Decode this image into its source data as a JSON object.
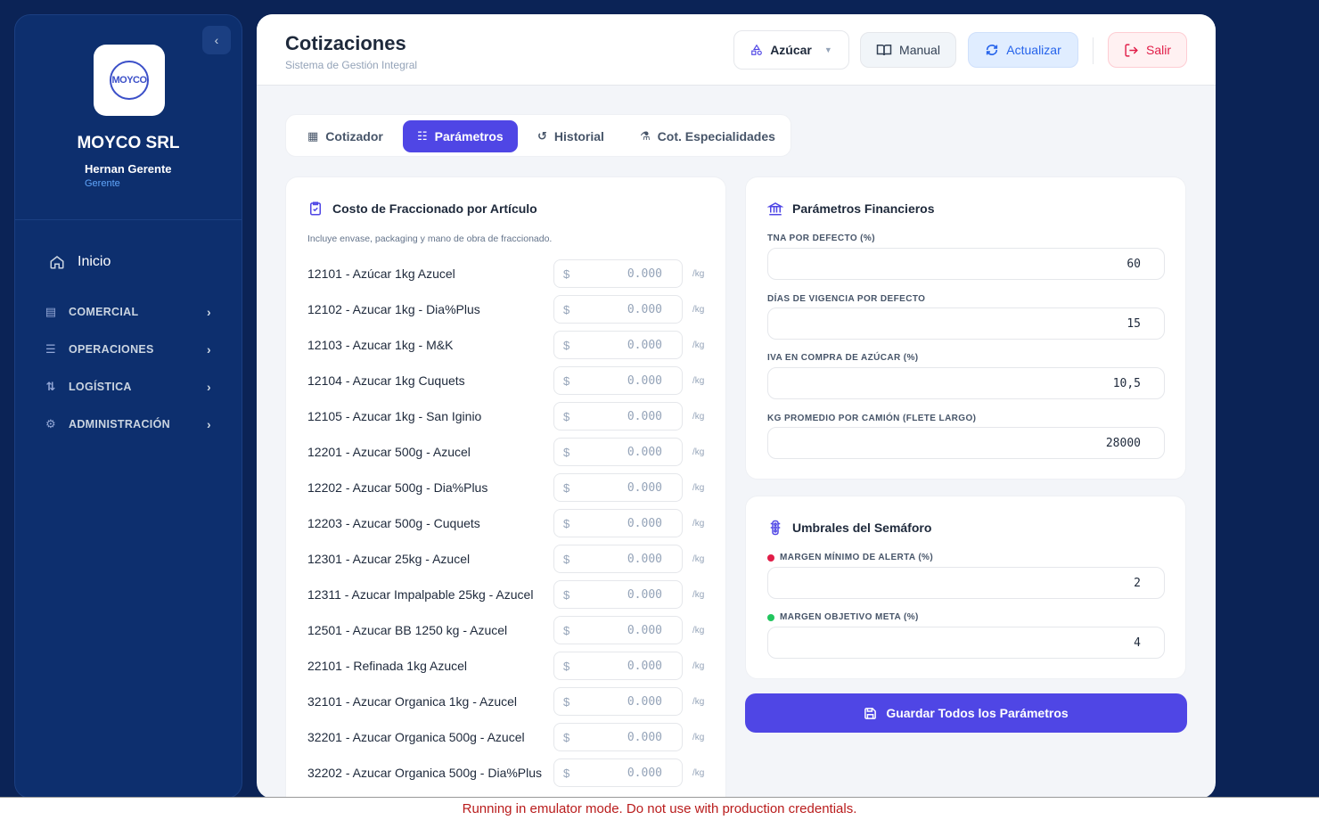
{
  "sidebar": {
    "collapse_icon": "chevron-left",
    "logo_text": "MOYCO",
    "company": "MOYCO SRL",
    "user_name": "Hernan Gerente",
    "user_role": "Gerente",
    "home_label": "Inicio",
    "sections": [
      {
        "label": "COMERCIAL",
        "icon": "store-icon"
      },
      {
        "label": "OPERACIONES",
        "icon": "stack-icon"
      },
      {
        "label": "LOGÍSTICA",
        "icon": "route-icon"
      },
      {
        "label": "ADMINISTRACIÓN",
        "icon": "admin-gear-icon"
      }
    ]
  },
  "header": {
    "title": "Cotizaciones",
    "subtitle": "Sistema de Gestión Integral",
    "product_select": "Azúcar",
    "manual_label": "Manual",
    "refresh_label": "Actualizar",
    "exit_label": "Salir"
  },
  "tabs": [
    {
      "label": "Cotizador",
      "icon": "calculator-icon"
    },
    {
      "label": "Parámetros",
      "icon": "sliders-icon",
      "active": true
    },
    {
      "label": "Historial",
      "icon": "history-icon"
    },
    {
      "label": "Cot. Especialidades",
      "icon": "flask-icon"
    }
  ],
  "fraccionado": {
    "title": "Costo de Fraccionado por Artículo",
    "description": "Incluye envase, packaging y mano de obra de fraccionado.",
    "currency": "$",
    "placeholder": "0.000",
    "unit": "/kg",
    "items": [
      "12101 - Azúcar 1kg Azucel",
      "12102 - Azucar 1kg - Dia%Plus",
      "12103 - Azucar 1kg - M&K",
      "12104 - Azucar 1kg Cuquets",
      "12105 - Azucar 1kg - San Iginio",
      "12201 - Azucar 500g - Azucel",
      "12202 - Azucar 500g - Dia%Plus",
      "12203 - Azucar 500g - Cuquets",
      "12301 - Azucar 25kg - Azucel",
      "12311 - Azucar Impalpable 25kg - Azucel",
      "12501 - Azucar BB 1250 kg - Azucel",
      "22101 - Refinada 1kg Azucel",
      "32101 - Azucar Organica 1kg - Azucel",
      "32201 - Azucar Organica 500g - Azucel",
      "32202 - Azucar Organica 500g - Dia%Plus"
    ]
  },
  "financieros": {
    "title": "Parámetros Financieros",
    "fields": [
      {
        "label": "TNA POR DEFECTO (%)",
        "value": "60"
      },
      {
        "label": "DÍAS DE VIGENCIA POR DEFECTO",
        "value": "15"
      },
      {
        "label": "IVA EN COMPRA DE AZÚCAR (%)",
        "value": "10,5"
      },
      {
        "label": "KG PROMEDIO POR CAMIÓN (FLETE LARGO)",
        "value": "28000"
      }
    ]
  },
  "semaforo": {
    "title": "Umbrales del Semáforo",
    "fields": [
      {
        "label": "MARGEN MÍNIMO DE ALERTA (%)",
        "value": "2",
        "color": "#e11d48"
      },
      {
        "label": "MARGEN OBJETIVO META (%)",
        "value": "4",
        "color": "#22c55e"
      }
    ]
  },
  "save_label": "Guardar Todos los Parámetros",
  "footer_notice": "Running in emulator mode. Do not use with production credentials.",
  "colors": {
    "accent": "#4f46e5",
    "sidebar": "#0d2f6e",
    "background": "#0b2356"
  }
}
